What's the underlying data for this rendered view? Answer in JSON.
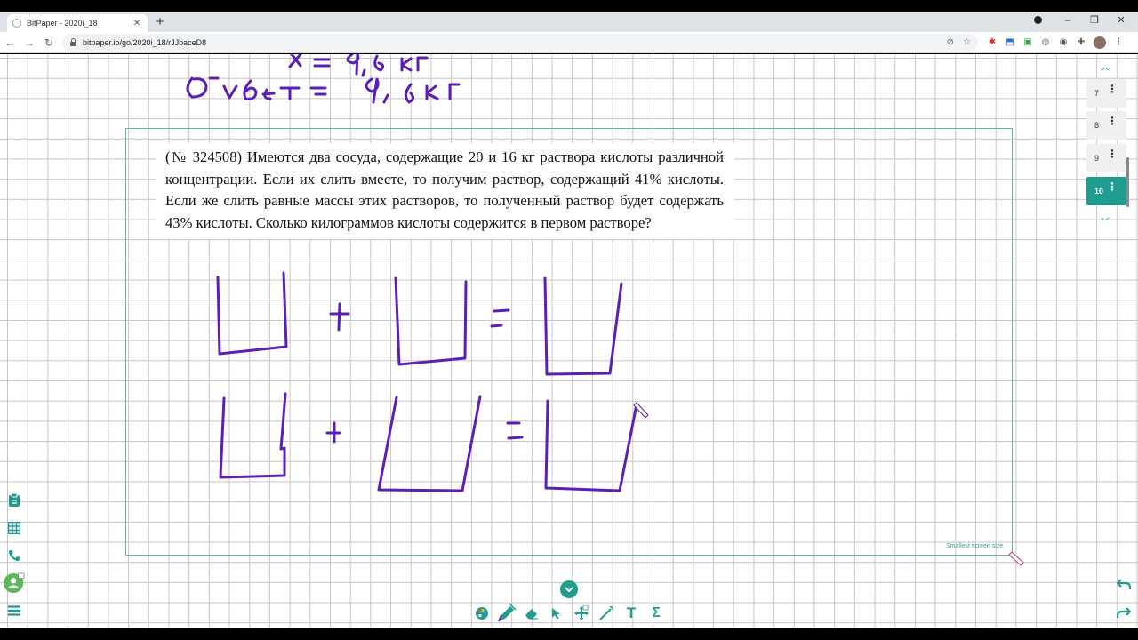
{
  "browser": {
    "tab_title": "BitPaper - 2020i_18",
    "tab_close": "✕",
    "new_tab": "+",
    "url": "bitpaper.io/go/2020i_18/rJJbaceD8",
    "window_controls": {
      "minimize": "–",
      "restore": "❐",
      "close": "✕"
    }
  },
  "problem": {
    "text": "(№ 324508) Имеются два сосуда, содержащие 20 и 16 кг раствора кислоты различной концентрации. Если их слить вместе, то получим раствор, содержащий 41% кислоты. Если же слить равные массы этих растворов, то полученный раствор будет содержать 43% кислоты. Сколько килограммов кислоты содержится в первом растворе?"
  },
  "frame_note": "Smallest screen size",
  "handwriting": {
    "line1": "x = 9,6 кг",
    "line2": "Ответ: 9,6 кг"
  },
  "pages": [
    {
      "number": "7",
      "active": false
    },
    {
      "number": "8",
      "active": false
    },
    {
      "number": "9",
      "active": false
    },
    {
      "number": "10",
      "active": true
    }
  ],
  "colors": {
    "accent": "#1f9e90",
    "ink": "#5b1fb8",
    "grid": "#c6c6c6"
  },
  "icons": {
    "left_toolbar": [
      "clipboard-icon",
      "grid-icon",
      "phone-icon",
      "add-user-icon",
      "menu-icon"
    ],
    "bottom_toolbar": [
      "palette-icon",
      "pen-icon",
      "eraser-icon",
      "pointer-icon",
      "move-icon",
      "laser-icon",
      "text-icon",
      "sigma-icon"
    ]
  },
  "bottom_toolbar_labels": {
    "text": "T",
    "sigma": "Σ"
  }
}
